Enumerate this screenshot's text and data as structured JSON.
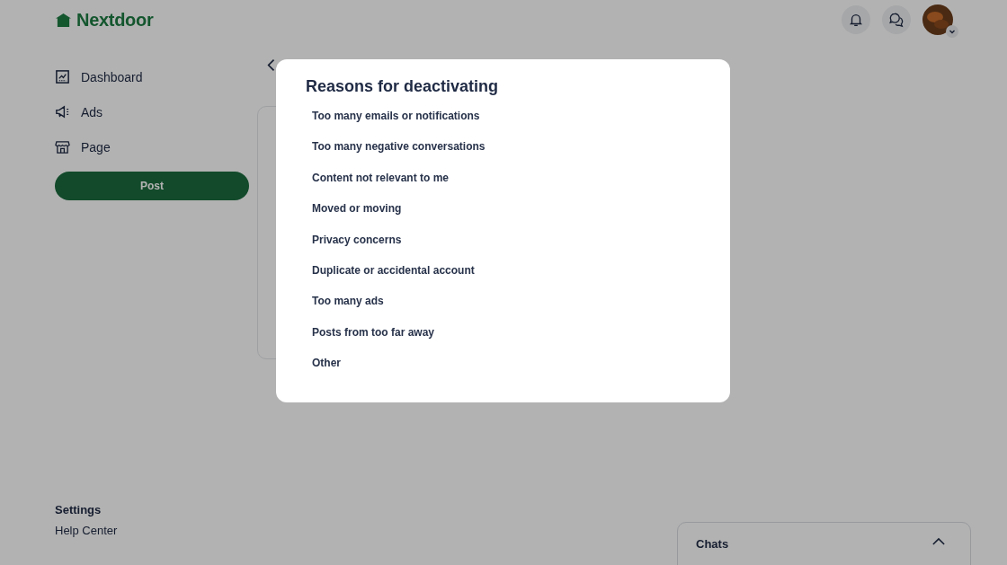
{
  "header": {
    "logo": "Nextdoor"
  },
  "sidebar": {
    "items": [
      {
        "label": "Dashboard"
      },
      {
        "label": "Ads"
      },
      {
        "label": "Page"
      }
    ],
    "post_button": "Post",
    "footer_links": [
      {
        "label": "Settings",
        "kind": "bold"
      },
      {
        "label": "Help Center",
        "kind": "plain"
      }
    ]
  },
  "chats": {
    "title": "Chats"
  },
  "modal": {
    "title": "Reasons for deactivating",
    "options": [
      "Too many emails or notifications",
      "Too many negative conversations",
      "Content not relevant to me",
      "Moved or moving",
      "Privacy concerns",
      "Duplicate or accidental account",
      "Too many ads",
      "Posts from too far away",
      "Other"
    ]
  }
}
